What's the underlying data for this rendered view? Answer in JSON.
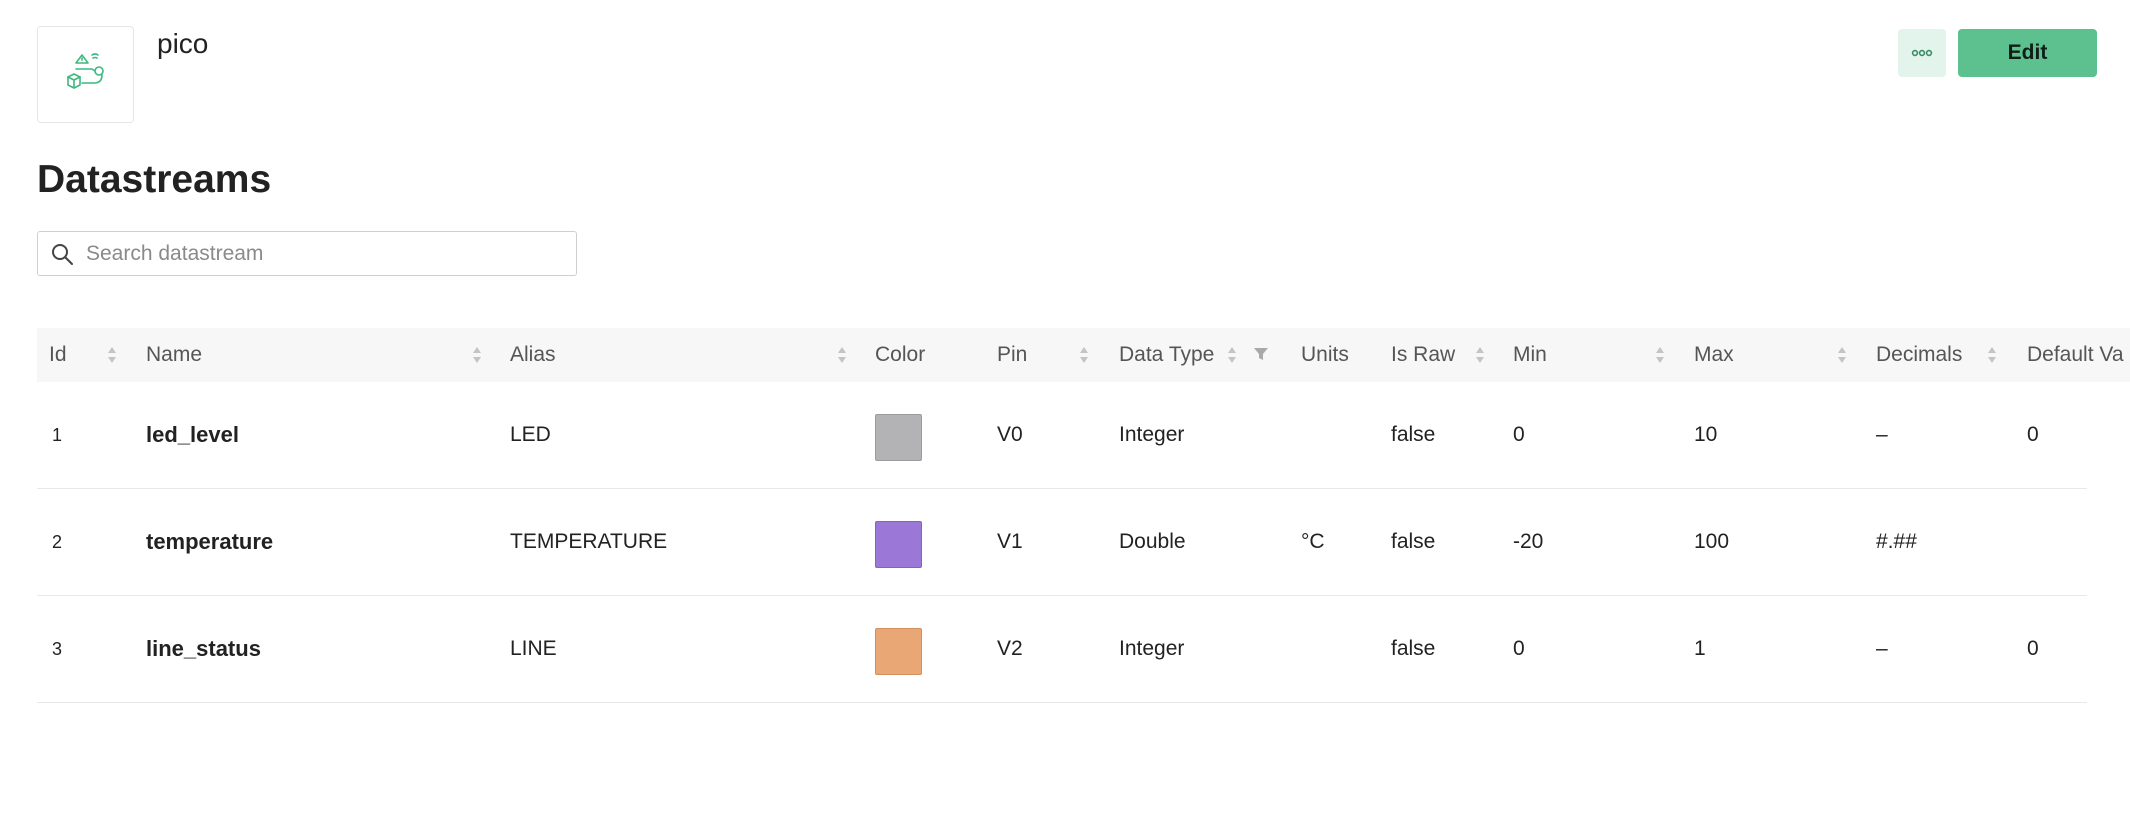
{
  "template": {
    "name": "pico"
  },
  "actions": {
    "edit_label": "Edit"
  },
  "section": {
    "title": "Datastreams"
  },
  "search": {
    "placeholder": "Search datastream",
    "value": ""
  },
  "table": {
    "columns": [
      "Id",
      "Name",
      "Alias",
      "Color",
      "Pin",
      "Data Type",
      "Units",
      "Is Raw",
      "Min",
      "Max",
      "Decimals",
      "Default Va"
    ],
    "rows": [
      {
        "id": "1",
        "name": "led_level",
        "alias": "LED",
        "color": "#b3b3b5",
        "pin": "V0",
        "data_type": "Integer",
        "units": "",
        "is_raw": "false",
        "min": "0",
        "max": "10",
        "decimals": "–",
        "default": "0"
      },
      {
        "id": "2",
        "name": "temperature",
        "alias": "TEMPERATURE",
        "color": "#9b78d8",
        "pin": "V1",
        "data_type": "Double",
        "units": "°C",
        "is_raw": "false",
        "min": "-20",
        "max": "100",
        "decimals": "#.##",
        "default": ""
      },
      {
        "id": "3",
        "name": "line_status",
        "alias": "LINE",
        "color": "#e8a775",
        "pin": "V2",
        "data_type": "Integer",
        "units": "",
        "is_raw": "false",
        "min": "0",
        "max": "1",
        "decimals": "–",
        "default": "0"
      }
    ]
  },
  "icons": {
    "logo": "device-template-icon",
    "more": "more-options-icon",
    "search": "search-icon",
    "sort": "sort-icon",
    "filter": "filter-icon"
  },
  "colors": {
    "accent": "#5dc08f",
    "accent_light": "#e3f4ec"
  }
}
